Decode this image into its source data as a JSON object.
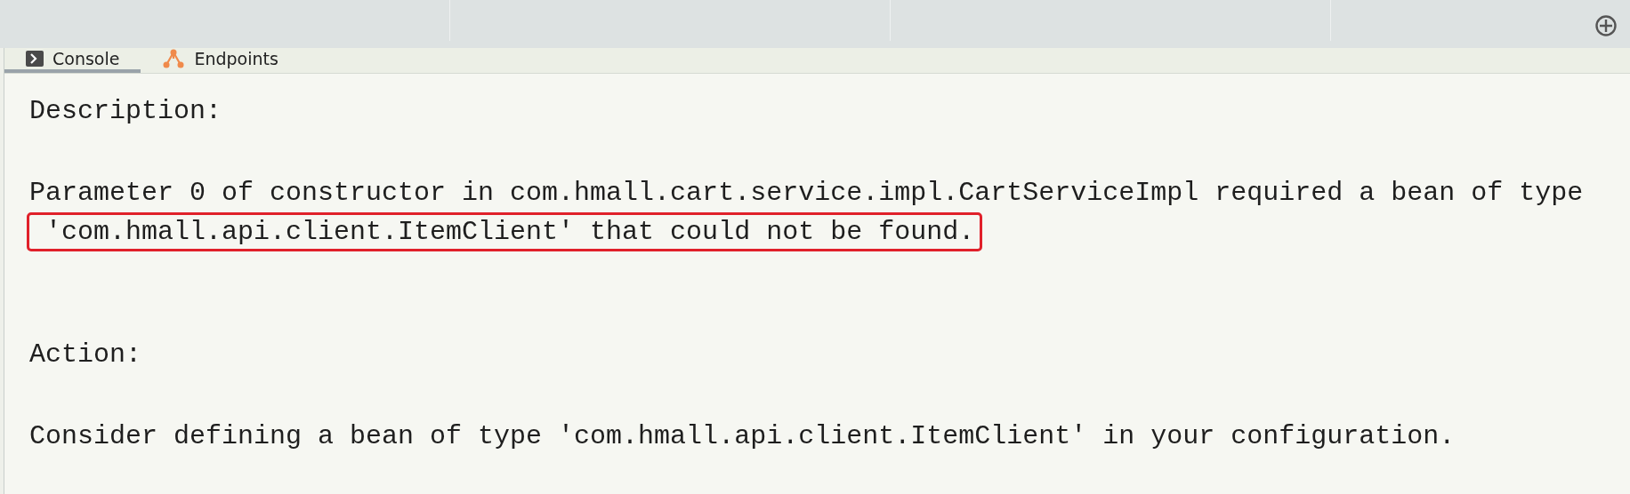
{
  "tabs": [
    {
      "label": "Console",
      "kind": "console",
      "selected": true
    },
    {
      "label": "Endpoints",
      "kind": "endpoints",
      "selected": false
    }
  ],
  "console": {
    "paragraphs": [
      {
        "lines": [
          {
            "text": "Description:",
            "highlighted": false
          }
        ]
      },
      {
        "lines": [
          {
            "text": "Parameter 0 of constructor in com.hmall.cart.service.impl.CartServiceImpl required a bean of type",
            "highlighted": false
          },
          {
            "text": " 'com.hmall.api.client.ItemClient' that could not be found.",
            "highlighted": true
          }
        ]
      },
      {
        "lines": [
          {
            "text": "Action:",
            "highlighted": false
          }
        ]
      },
      {
        "lines": [
          {
            "text": "Consider defining a bean of type 'com.hmall.api.client.ItemClient' in your configuration.",
            "highlighted": false
          }
        ]
      }
    ]
  }
}
